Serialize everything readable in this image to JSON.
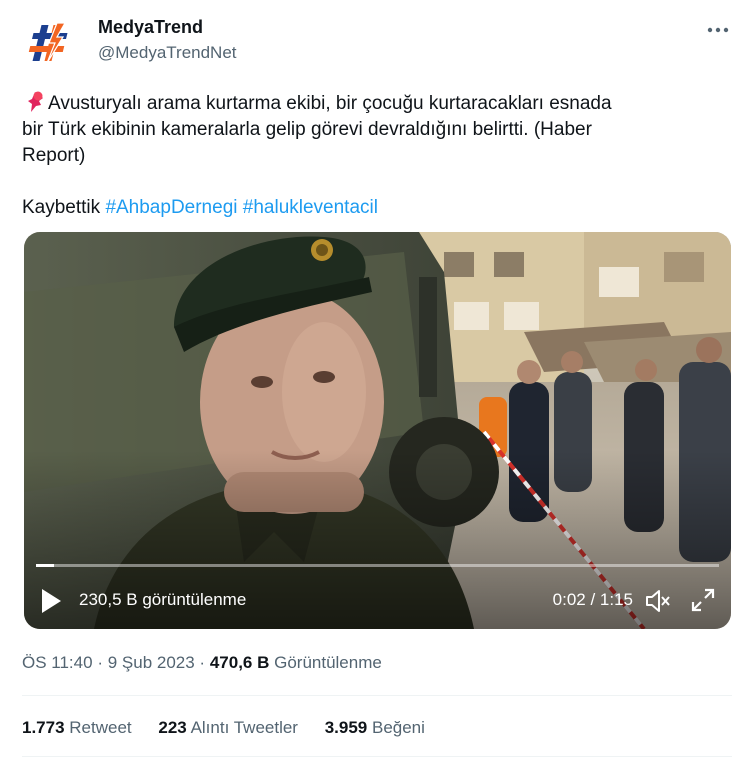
{
  "author": {
    "display_name": "MedyaTrend",
    "handle": "@MedyaTrendNet",
    "avatar_icon": "medyatrend-logo",
    "brand_colors": [
      "#1c3f8f",
      "#f26522"
    ]
  },
  "more_icon": "more-dots-icon",
  "tweet": {
    "pin_icon": "pushpin-emoji",
    "text_line1": "Avusturyalı arama kurtarma ekibi, bir çocuğu kurtaracakları esnada",
    "text_line2": "bir Türk ekibinin kameralarla gelip görevi devraldığını belirtti. (Haber",
    "text_line3": "Report)",
    "text_word": "Kaybettik",
    "hashtags": [
      "#AhbapDernegi",
      "#halukleventacil"
    ],
    "link_color": "#1d9bf0"
  },
  "video": {
    "views_label": "230,5 B görüntülenme",
    "time_label": "0:02 / 1:15",
    "progress": 0.027,
    "play_icon": "play-icon",
    "volume_icon": "volume-icon",
    "fullscreen_icon": "fullscreen-icon"
  },
  "meta": {
    "time": "ÖS 11:40",
    "separator": "·",
    "date": "9 Şub 2023",
    "views_count": "470,6 B",
    "views_label": "Görüntülenme"
  },
  "stats": {
    "retweets_count": "1.773",
    "retweets_label": "Retweet",
    "quotes_count": "223",
    "quotes_label": "Alıntı Tweetler",
    "likes_count": "3.959",
    "likes_label": "Beğeni"
  }
}
